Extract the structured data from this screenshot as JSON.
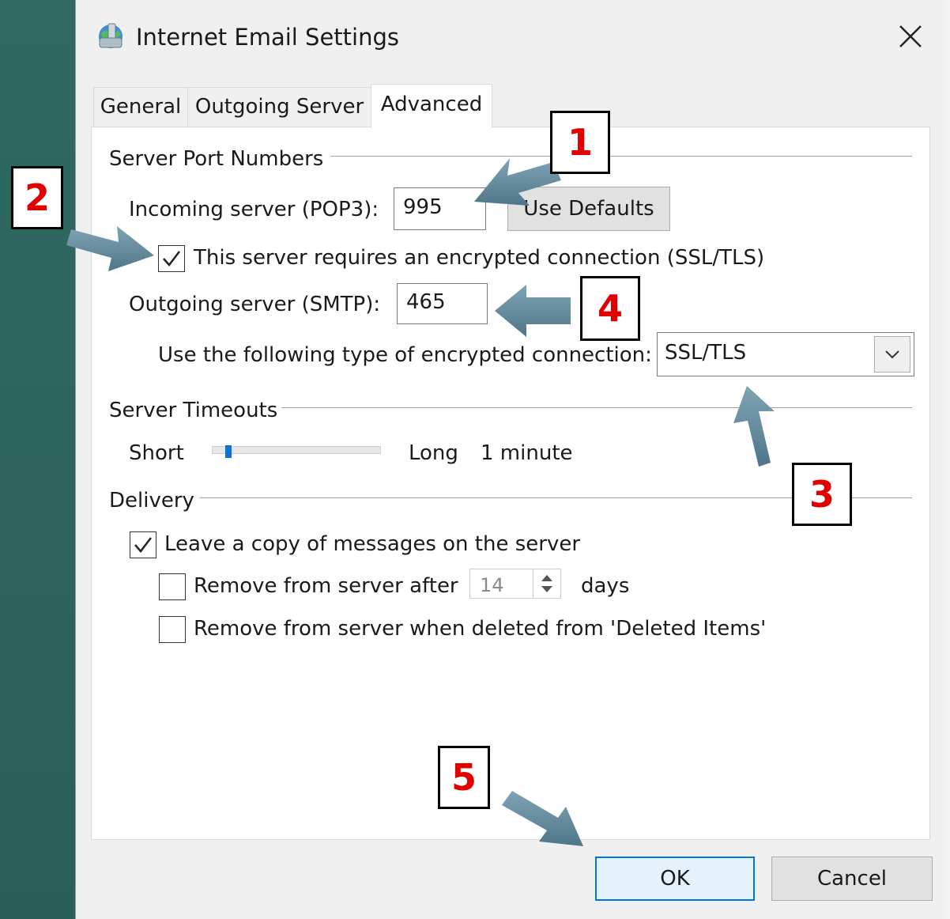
{
  "window": {
    "title": "Internet Email Settings"
  },
  "tabs": [
    {
      "label": "General",
      "active": false
    },
    {
      "label": "Outgoing Server",
      "active": false
    },
    {
      "label": "Advanced",
      "active": true
    }
  ],
  "server_ports": {
    "group_label": "Server Port Numbers",
    "incoming_label": "Incoming server (POP3):",
    "incoming_value": "995",
    "use_defaults_label": "Use Defaults",
    "ssl_checkbox_label": "This server requires an encrypted connection (SSL/TLS)",
    "ssl_checked": true,
    "outgoing_label": "Outgoing server (SMTP):",
    "outgoing_value": "465",
    "encryption_label": "Use the following type of encrypted connection:",
    "encryption_value": "SSL/TLS"
  },
  "timeouts": {
    "group_label": "Server Timeouts",
    "short_label": "Short",
    "long_label": "Long",
    "value_text": "1 minute",
    "slider_fraction": 0.08
  },
  "delivery": {
    "group_label": "Delivery",
    "leave_copy_label": "Leave a copy of messages on the server",
    "leave_copy_checked": true,
    "remove_after_label": "Remove from server after",
    "remove_after_checked": false,
    "remove_after_days": "14",
    "days_label": "days",
    "remove_deleted_label": "Remove from server when deleted from 'Deleted Items'",
    "remove_deleted_checked": false
  },
  "buttons": {
    "ok": "OK",
    "cancel": "Cancel"
  },
  "callouts": [
    "1",
    "2",
    "3",
    "4",
    "5"
  ],
  "colors": {
    "callout_text": "#e00000",
    "arrow": "#5f8aa0",
    "background": "#2f6a63",
    "slider_thumb": "#0a74da"
  },
  "icons": {
    "title": "globe-mail-icon",
    "close": "close-icon",
    "dropdown": "chevron-down-icon",
    "checkbox": "checkmark-icon"
  }
}
